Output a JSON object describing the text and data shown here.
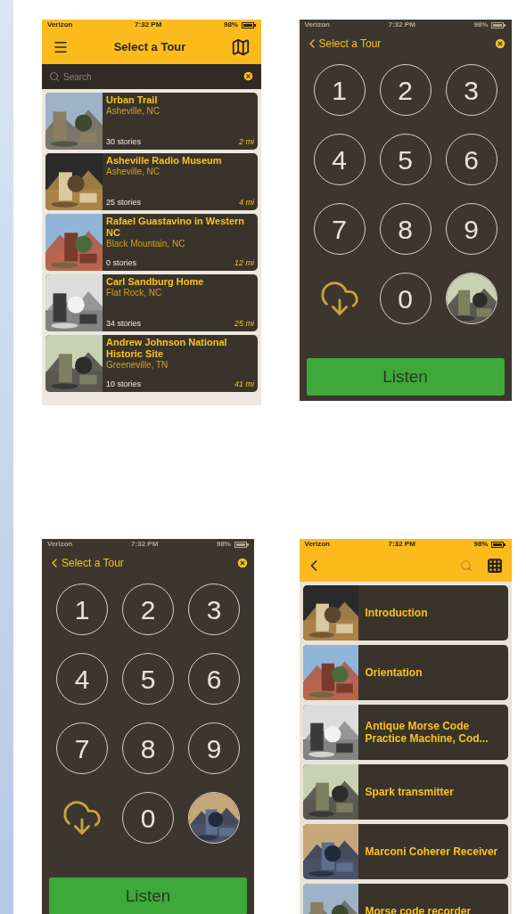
{
  "screens": [
    {
      "kind": "tour_list",
      "status": {
        "carrier": "Verizon",
        "time": "7:32 PM",
        "battery": "98%"
      },
      "title": "Select a Tour",
      "search": {
        "placeholder": "Search"
      },
      "tours": [
        {
          "name": "Urban Trail",
          "location": "Asheville, NC",
          "stories": "30 stories",
          "distance": "2 mi"
        },
        {
          "name": "Asheville Radio Museum",
          "location": "Asheville, NC",
          "stories": "25 stories",
          "distance": "4 mi"
        },
        {
          "name": "Rafael Guastavino in Western NC",
          "location": "Black Mountain, NC",
          "stories": "0 stories",
          "distance": "12 mi"
        },
        {
          "name": "Carl Sandburg Home",
          "location": "Flat Rock, NC",
          "stories": "34 stories",
          "distance": "25 mi"
        },
        {
          "name": "Andrew Johnson National Historic Site",
          "location": "Greeneville, TN",
          "stories": "10 stories",
          "distance": "41 mi"
        }
      ]
    },
    {
      "kind": "keypad",
      "status": {
        "carrier": "Verizon",
        "time": "7:32 PM",
        "battery": "98%"
      },
      "back_label": "Select a Tour",
      "keys": [
        "1",
        "2",
        "3",
        "4",
        "5",
        "6",
        "7",
        "8",
        "9",
        "0"
      ],
      "button": "Listen"
    },
    {
      "kind": "keypad",
      "status": {
        "carrier": "Verizon",
        "time": "7:32 PM",
        "battery": "98%"
      },
      "back_label": "Select a Tour",
      "keys": [
        "1",
        "2",
        "3",
        "4",
        "5",
        "6",
        "7",
        "8",
        "9",
        "0"
      ],
      "button": "Listen"
    },
    {
      "kind": "stop_list",
      "status": {
        "carrier": "Verizon",
        "time": "7:32 PM",
        "battery": "98%"
      },
      "stops": [
        {
          "title": "Introduction"
        },
        {
          "title": "Orientation"
        },
        {
          "title": "Antique Morse Code Practice Machine, Cod..."
        },
        {
          "title": "Spark transmitter"
        },
        {
          "title": "Marconi Coherer Receiver"
        },
        {
          "title": "Morse code recorder"
        }
      ]
    }
  ]
}
